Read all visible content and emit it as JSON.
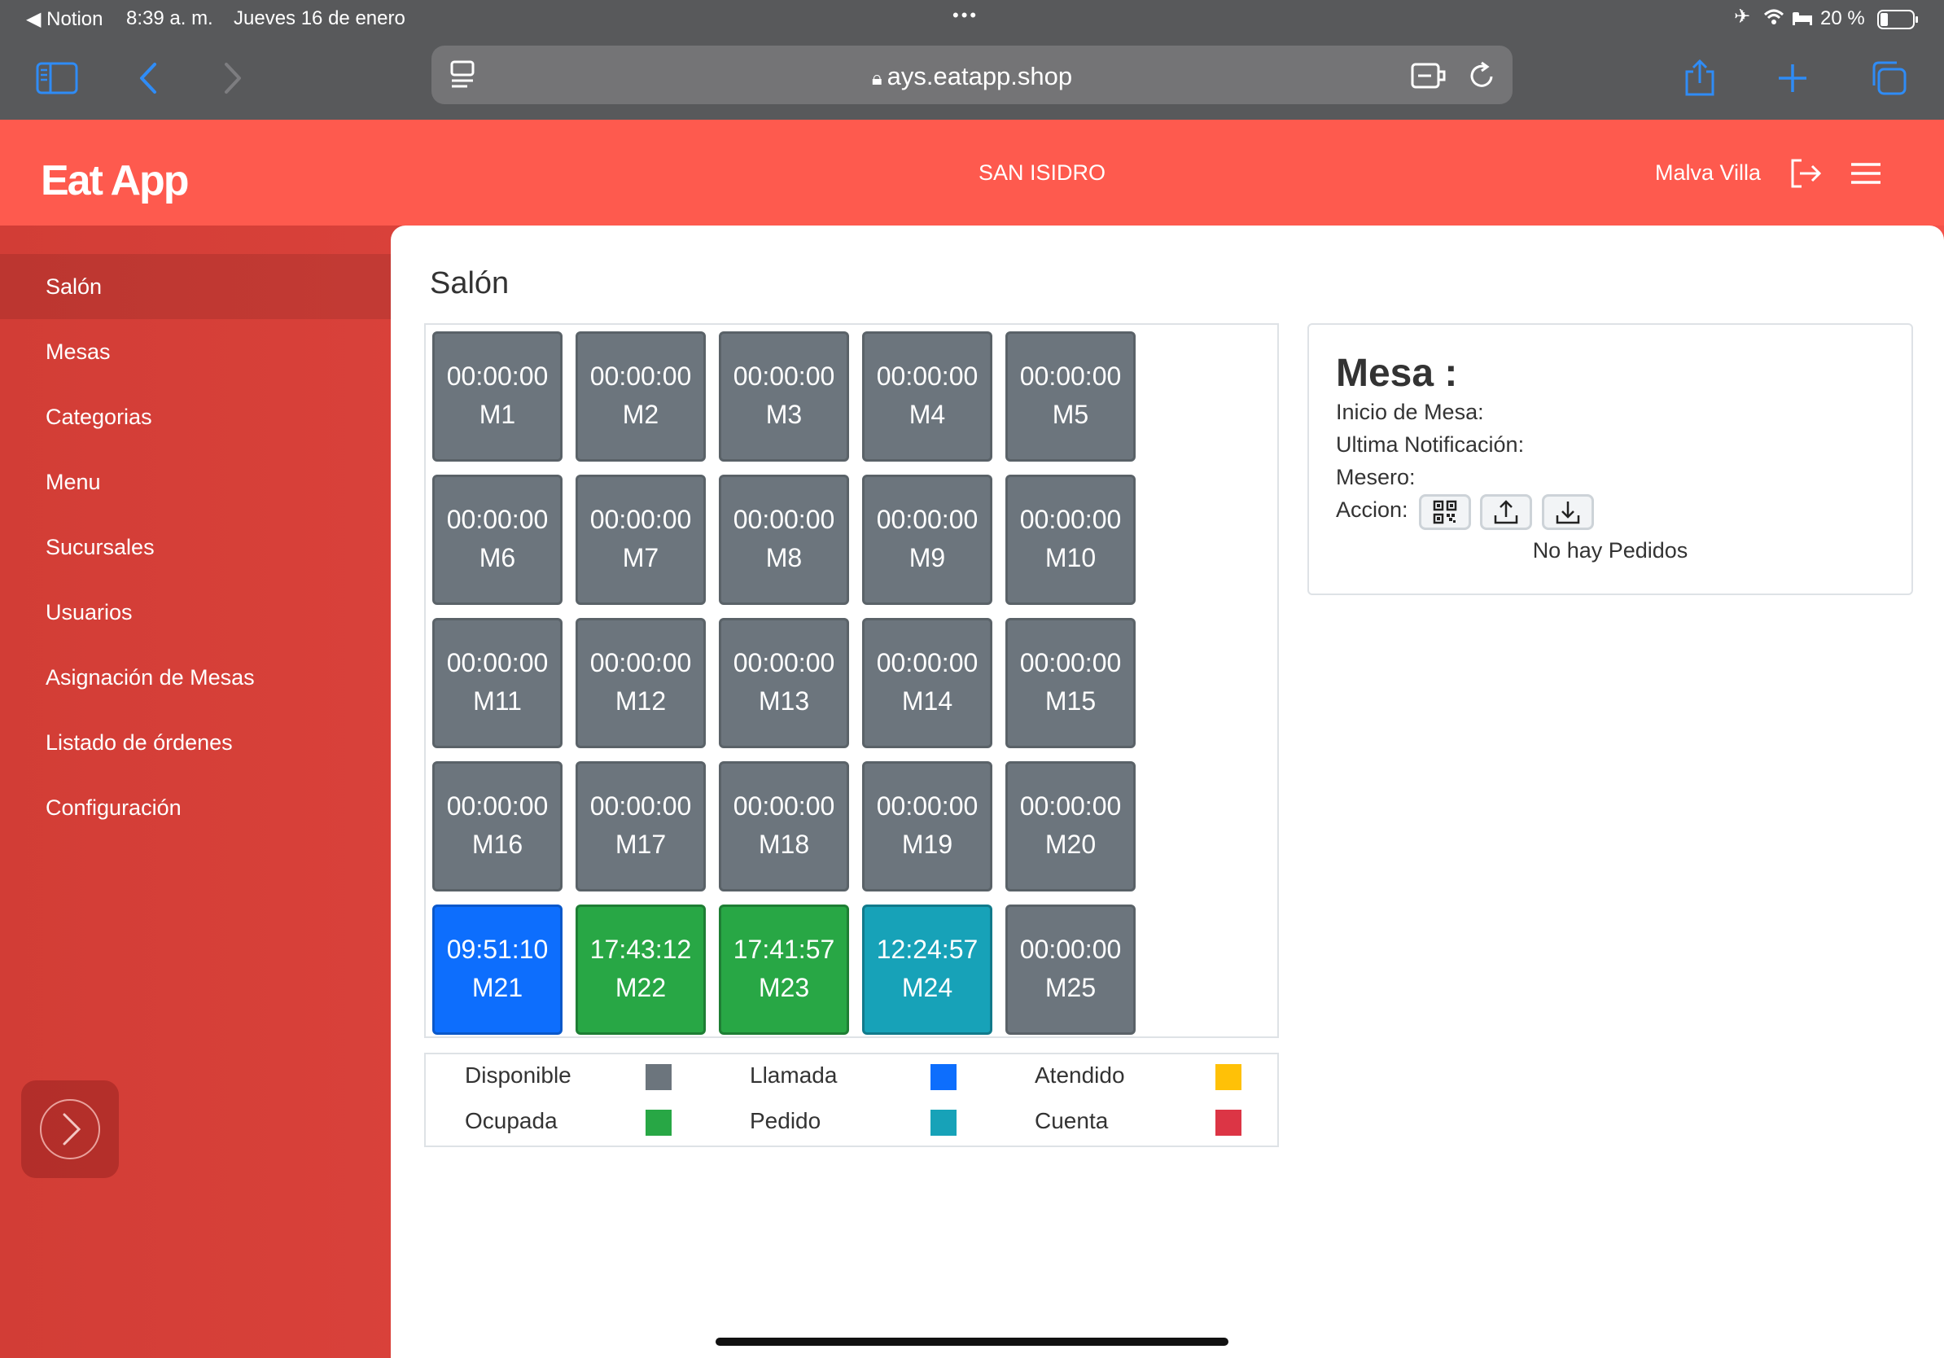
{
  "status_bar": {
    "back_app": "◀ Notion",
    "time": "8:39 a. m.",
    "date": "Jueves 16 de enero",
    "battery": "20 %"
  },
  "browser": {
    "url": "ays.eatapp.shop"
  },
  "header": {
    "logo": "Eat App",
    "branch": "SAN ISIDRO",
    "user": "Malva Villa"
  },
  "sidebar": {
    "items": [
      {
        "label": "Salón"
      },
      {
        "label": "Mesas"
      },
      {
        "label": "Categorias"
      },
      {
        "label": "Menu"
      },
      {
        "label": "Sucursales"
      },
      {
        "label": "Usuarios"
      },
      {
        "label": "Asignación de Mesas"
      },
      {
        "label": "Listado de órdenes"
      },
      {
        "label": "Configuración"
      }
    ]
  },
  "main": {
    "title": "Salón",
    "tables": [
      {
        "name": "M1",
        "time": "00:00:00",
        "status": "disponible"
      },
      {
        "name": "M2",
        "time": "00:00:00",
        "status": "disponible"
      },
      {
        "name": "M3",
        "time": "00:00:00",
        "status": "disponible"
      },
      {
        "name": "M4",
        "time": "00:00:00",
        "status": "disponible"
      },
      {
        "name": "M5",
        "time": "00:00:00",
        "status": "disponible"
      },
      {
        "name": "M6",
        "time": "00:00:00",
        "status": "disponible"
      },
      {
        "name": "M7",
        "time": "00:00:00",
        "status": "disponible"
      },
      {
        "name": "M8",
        "time": "00:00:00",
        "status": "disponible"
      },
      {
        "name": "M9",
        "time": "00:00:00",
        "status": "disponible"
      },
      {
        "name": "M10",
        "time": "00:00:00",
        "status": "disponible"
      },
      {
        "name": "M11",
        "time": "00:00:00",
        "status": "disponible"
      },
      {
        "name": "M12",
        "time": "00:00:00",
        "status": "disponible"
      },
      {
        "name": "M13",
        "time": "00:00:00",
        "status": "disponible"
      },
      {
        "name": "M14",
        "time": "00:00:00",
        "status": "disponible"
      },
      {
        "name": "M15",
        "time": "00:00:00",
        "status": "disponible"
      },
      {
        "name": "M16",
        "time": "00:00:00",
        "status": "disponible"
      },
      {
        "name": "M17",
        "time": "00:00:00",
        "status": "disponible"
      },
      {
        "name": "M18",
        "time": "00:00:00",
        "status": "disponible"
      },
      {
        "name": "M19",
        "time": "00:00:00",
        "status": "disponible"
      },
      {
        "name": "M20",
        "time": "00:00:00",
        "status": "disponible"
      },
      {
        "name": "M21",
        "time": "09:51:10",
        "status": "llamada"
      },
      {
        "name": "M22",
        "time": "17:43:12",
        "status": "ocupada"
      },
      {
        "name": "M23",
        "time": "17:41:57",
        "status": "ocupada"
      },
      {
        "name": "M24",
        "time": "12:24:57",
        "status": "pedido"
      },
      {
        "name": "M25",
        "time": "00:00:00",
        "status": "disponible"
      }
    ],
    "legend": [
      {
        "label": "Disponible",
        "color": "#6c757d"
      },
      {
        "label": "Llamada",
        "color": "#0d6efd"
      },
      {
        "label": "Atendido",
        "color": "#ffc107"
      },
      {
        "label": "Ocupada",
        "color": "#28a745"
      },
      {
        "label": "Pedido",
        "color": "#17a2b8"
      },
      {
        "label": "Cuenta",
        "color": "#dc3545"
      }
    ]
  },
  "detail": {
    "title": "Mesa :",
    "inicio_label": "Inicio de Mesa:",
    "notif_label": "Ultima Notificación:",
    "mesero_label": "Mesero:",
    "accion_label": "Accion:",
    "actions": [
      "qr-code-icon",
      "upload-icon",
      "download-icon"
    ],
    "empty_orders": "No hay Pedidos"
  }
}
